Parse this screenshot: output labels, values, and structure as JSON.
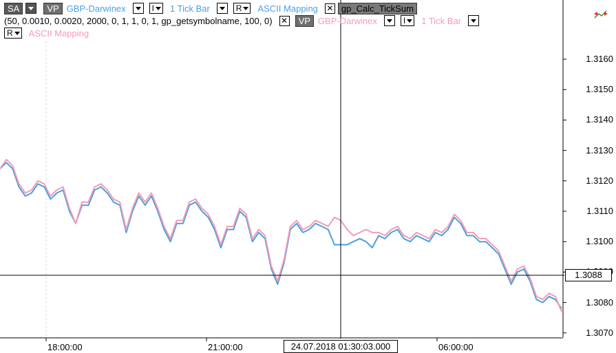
{
  "toolbar": {
    "sa_label": "SA",
    "vp_label": "VP",
    "instrument": "GBP-Darwinex",
    "bar_type_button": "I",
    "bar_type": "1 Tick Bar",
    "r_button": "R",
    "mapping": "ASCII Mapping",
    "indicator_name": "gp_Calc_TickSum",
    "params": "(50,  0.0010,  0.0020,  2000,  0,  1,  1,  0,  1,  gp_getsymbolname,  100,  0)",
    "overlay_vp_label": "VP",
    "overlay_instrument": "GBP-Darwinex",
    "overlay_bar_type_button": "I",
    "overlay_bar_type": "1 Tick Bar",
    "overlay_r_button": "R",
    "overlay_mapping": "ASCII Mapping"
  },
  "crosshair": {
    "price": "1.3088",
    "time": "24.07.2018 01:30:03.000"
  },
  "chart_data": {
    "type": "line",
    "y_tick_labels": [
      "1.3160",
      "1.3150",
      "1.3140",
      "1.3130",
      "1.3120",
      "1.3110",
      "1.3100",
      "1.3090",
      "1.3080",
      "1.3070"
    ],
    "x_tick_labels": [
      "18:00:00",
      "21:00:00",
      "06:00:00"
    ],
    "ylim": [
      1.3067,
      1.317
    ],
    "grid": false,
    "series": [
      {
        "name": "GBP-Darwinex",
        "color": "#4a9fe0",
        "values": [
          1.3124,
          1.3126,
          1.3124,
          1.3118,
          1.3115,
          1.3116,
          1.3119,
          1.3118,
          1.3114,
          1.3116,
          1.3117,
          1.311,
          1.3106,
          1.3112,
          1.3112,
          1.3117,
          1.3118,
          1.3116,
          1.3113,
          1.3112,
          1.3103,
          1.311,
          1.3115,
          1.3112,
          1.3115,
          1.311,
          1.3104,
          1.31,
          1.3106,
          1.3106,
          1.3112,
          1.3113,
          1.311,
          1.3108,
          1.3104,
          1.3098,
          1.3104,
          1.3104,
          1.311,
          1.3108,
          1.31,
          1.3103,
          1.3101,
          1.3091,
          1.3086,
          1.3093,
          1.3104,
          1.3106,
          1.3103,
          1.3104,
          1.3106,
          1.3105,
          1.3104,
          1.3099,
          1.3099,
          1.3099,
          1.31,
          1.3101,
          1.31,
          1.3098,
          1.3102,
          1.3101,
          1.3103,
          1.3104,
          1.3101,
          1.31,
          1.3102,
          1.3101,
          1.31,
          1.3103,
          1.3102,
          1.3104,
          1.3108,
          1.3106,
          1.3102,
          1.3102,
          1.31,
          1.31,
          1.3098,
          1.3096,
          1.3091,
          1.3086,
          1.309,
          1.3091,
          1.3087,
          1.3081,
          1.308,
          1.3082,
          1.3081,
          1.3078
        ]
      },
      {
        "name": "ASCII Mapping",
        "color": "#f59bb2",
        "values": [
          1.3124,
          1.3127,
          1.3125,
          1.3119,
          1.3116,
          1.3117,
          1.312,
          1.3119,
          1.3115,
          1.3117,
          1.3118,
          1.3111,
          1.3106,
          1.3113,
          1.3113,
          1.3118,
          1.3119,
          1.3117,
          1.3114,
          1.3113,
          1.3104,
          1.3111,
          1.3116,
          1.3113,
          1.3116,
          1.3111,
          1.3105,
          1.3101,
          1.3107,
          1.3107,
          1.3113,
          1.3114,
          1.3111,
          1.3109,
          1.3105,
          1.3099,
          1.3105,
          1.3105,
          1.3111,
          1.3109,
          1.3101,
          1.3104,
          1.3102,
          1.3092,
          1.3087,
          1.3094,
          1.3105,
          1.3107,
          1.3104,
          1.3105,
          1.3107,
          1.3106,
          1.3105,
          1.3108,
          1.3107,
          1.3104,
          1.3102,
          1.3103,
          1.3104,
          1.3103,
          1.3103,
          1.3102,
          1.3104,
          1.3105,
          1.3102,
          1.3101,
          1.3103,
          1.3102,
          1.3101,
          1.3104,
          1.3103,
          1.3105,
          1.3109,
          1.3107,
          1.3103,
          1.3103,
          1.3101,
          1.3101,
          1.3099,
          1.3097,
          1.3092,
          1.3087,
          1.3091,
          1.3092,
          1.3088,
          1.3082,
          1.3081,
          1.3083,
          1.3082,
          1.3077
        ]
      }
    ]
  }
}
